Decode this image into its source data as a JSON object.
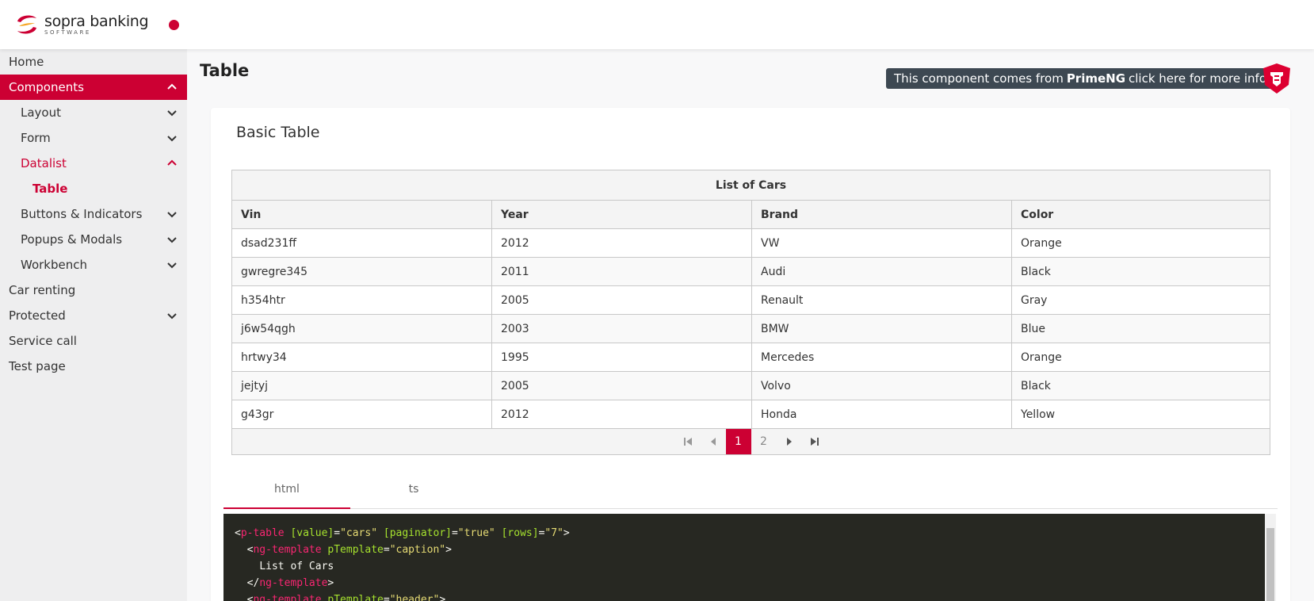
{
  "header": {
    "logo_name": "sopra banking",
    "logo_sub": "SOFTWARE"
  },
  "sidebar": {
    "items": [
      {
        "label": "Home"
      },
      {
        "label": "Components"
      },
      {
        "label": "Layout"
      },
      {
        "label": "Form"
      },
      {
        "label": "Datalist"
      },
      {
        "label": "Table"
      },
      {
        "label": "Buttons & Indicators"
      },
      {
        "label": "Popups & Modals"
      },
      {
        "label": "Workbench"
      },
      {
        "label": "Car renting"
      },
      {
        "label": "Protected"
      },
      {
        "label": "Service call"
      },
      {
        "label": "Test page"
      }
    ]
  },
  "main": {
    "title": "Table",
    "primeng_prefix": "This component comes from",
    "primeng_name": "PrimeNG",
    "primeng_suffix": "click here for more info",
    "card_title": "Basic Table"
  },
  "table": {
    "caption": "List of Cars",
    "columns": [
      "Vin",
      "Year",
      "Brand",
      "Color"
    ],
    "rows": [
      [
        "dsad231ff",
        "2012",
        "VW",
        "Orange"
      ],
      [
        "gwregre345",
        "2011",
        "Audi",
        "Black"
      ],
      [
        "h354htr",
        "2005",
        "Renault",
        "Gray"
      ],
      [
        "j6w54qgh",
        "2003",
        "BMW",
        "Blue"
      ],
      [
        "hrtwy34",
        "1995",
        "Mercedes",
        "Orange"
      ],
      [
        "jejtyj",
        "2005",
        "Volvo",
        "Black"
      ],
      [
        "g43gr",
        "2012",
        "Honda",
        "Yellow"
      ]
    ],
    "pages": [
      "1",
      "2"
    ],
    "current_page": "1"
  },
  "tabs": [
    {
      "label": "html"
    },
    {
      "label": "ts"
    }
  ],
  "code": {
    "l1_tag": "p-table",
    "l1_a1": "[value]",
    "l1_v1": "\"cars\"",
    "l1_a2": "[paginator]",
    "l1_v2": "\"true\"",
    "l1_a3": "[rows]",
    "l1_v3": "\"7\"",
    "l2_tag": "ng-template",
    "l2_a1": "pTemplate",
    "l2_v1": "\"caption\"",
    "l3_text": "List of Cars",
    "l4_tag": "ng-template",
    "l5_tag": "ng-template",
    "l5_a1": "pTemplate",
    "l5_v1": "\"header\""
  },
  "colors": {
    "accent": "#cc0033",
    "sidebar_bg": "#eeeeef",
    "code_bg": "#272822"
  }
}
